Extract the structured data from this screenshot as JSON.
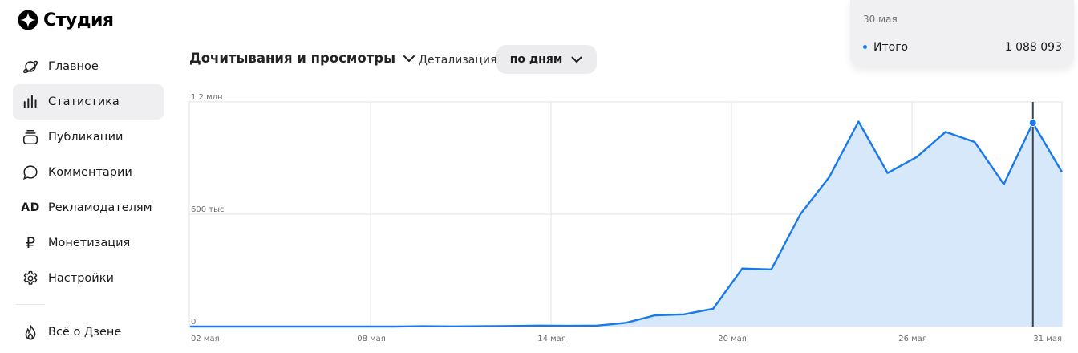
{
  "app": {
    "title": "Студия"
  },
  "sidebar": {
    "items": [
      {
        "label": "Главное",
        "icon": "planet-icon"
      },
      {
        "label": "Статистика",
        "icon": "bar-chart-icon",
        "active": true
      },
      {
        "label": "Публикации",
        "icon": "stack-icon"
      },
      {
        "label": "Комментарии",
        "icon": "comment-icon"
      },
      {
        "label": "Рекламодателям",
        "icon": "ad-icon",
        "glyph": "AD"
      },
      {
        "label": "Монетизация",
        "icon": "ruble-icon",
        "glyph": "₽"
      },
      {
        "label": "Настройки",
        "icon": "gear-icon"
      }
    ],
    "footer_item": {
      "label": "Всё о Дзене",
      "icon": "flame-icon"
    }
  },
  "toolbar": {
    "metric_label": "Дочитывания и просмотры",
    "detail_label": "Детализация",
    "detail_value": "по дням"
  },
  "tooltip": {
    "date": "30 мая",
    "series_name": "Итого",
    "value": "1 088 093"
  },
  "colors": {
    "accent": "#1a79e9",
    "fill": "#d7e8fb",
    "cursor": "#3d4650"
  },
  "chart_data": {
    "type": "area",
    "x_start_label": "02 мая",
    "x": [
      "02 мая",
      "03 мая",
      "04 мая",
      "05 мая",
      "06 мая",
      "07 мая",
      "08 мая",
      "09 мая",
      "10 мая",
      "11 мая",
      "12 мая",
      "13 мая",
      "14 мая",
      "15 мая",
      "16 мая",
      "17 мая",
      "18 мая",
      "19 мая",
      "20 мая",
      "21 мая",
      "22 мая",
      "23 мая",
      "24 мая",
      "25 мая",
      "26 мая",
      "27 мая",
      "28 мая",
      "29 мая",
      "30 мая",
      "31 мая"
    ],
    "tick_labels": [
      "02 мая",
      "08 мая",
      "14 мая",
      "20 мая",
      "26 мая",
      "31 мая"
    ],
    "series": [
      {
        "values": [
          0,
          0,
          0,
          0,
          0,
          0,
          0,
          0,
          2000,
          1000,
          2000,
          3000,
          5000,
          4000,
          5000,
          20000,
          60000,
          65000,
          95000,
          310000,
          305000,
          600000,
          800000,
          1095000,
          820000,
          905000,
          1040000,
          985000,
          760000,
          1088093,
          825000
        ]
      }
    ],
    "ylim": [
      0,
      1200000
    ],
    "y_ticks": [
      0,
      600000,
      1200000
    ],
    "y_tick_labels": [
      "0",
      "600 тыс",
      "1.2 млн"
    ],
    "highlighted": "30 мая",
    "grid": true
  }
}
